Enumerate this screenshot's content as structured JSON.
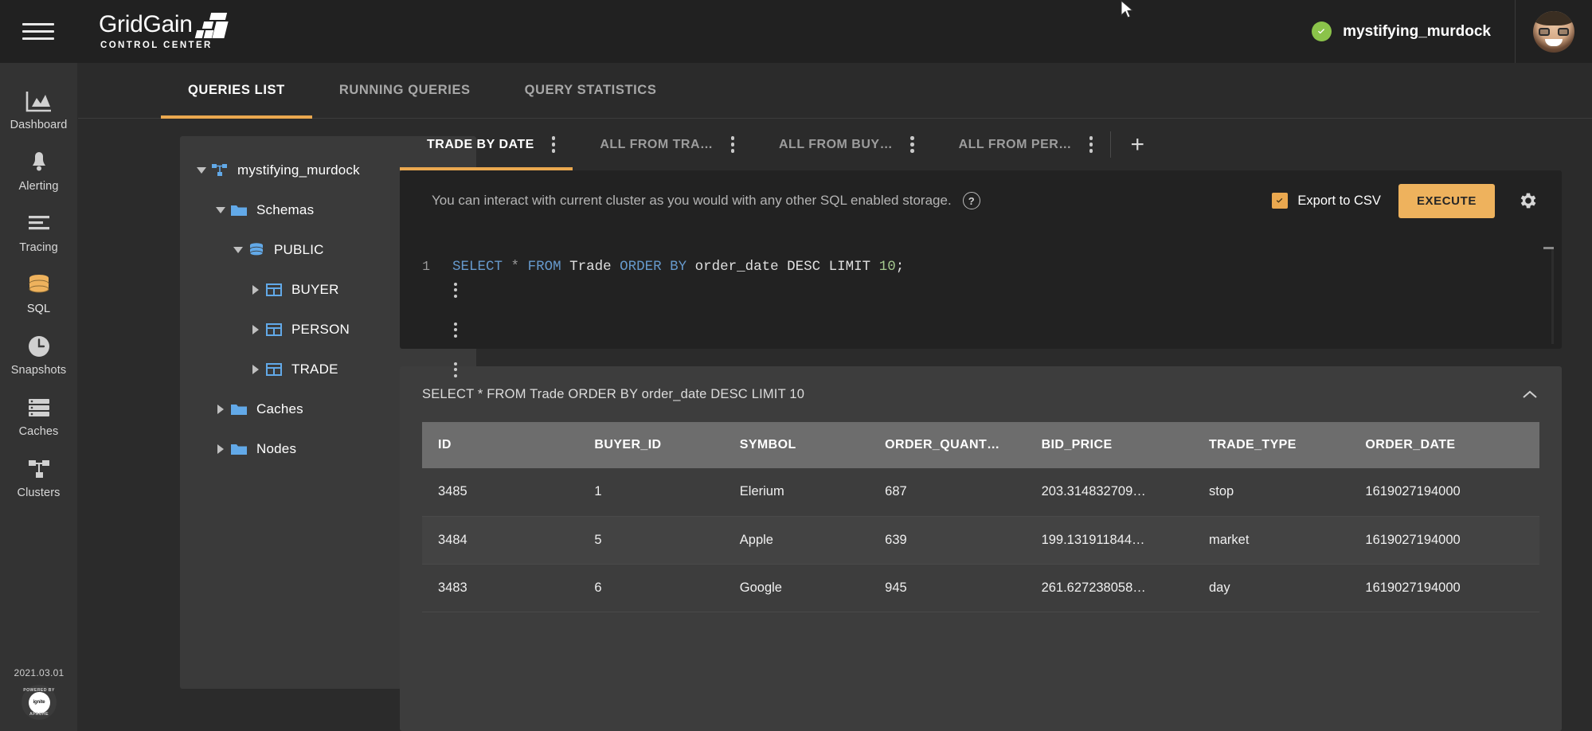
{
  "topbar": {
    "menu_icon": "hamburger-icon",
    "brand_name": "GridGain",
    "brand_sub": "CONTROL CENTER",
    "cluster_name": "mystifying_murdock",
    "status_icon": "check-circle-icon",
    "status_color": "#8bc34a",
    "avatar_alt": "user-avatar"
  },
  "rail": {
    "items": [
      {
        "label": "Dashboard",
        "icon": "chart-area-icon",
        "active": false
      },
      {
        "label": "Alerting",
        "icon": "bell-icon",
        "active": false
      },
      {
        "label": "Tracing",
        "icon": "lines-icon",
        "active": false
      },
      {
        "label": "SQL",
        "icon": "database-icon",
        "active": true
      },
      {
        "label": "Snapshots",
        "icon": "clock-icon",
        "active": false
      },
      {
        "label": "Caches",
        "icon": "server-icon",
        "active": false
      },
      {
        "label": "Clusters",
        "icon": "topology-icon",
        "active": false
      }
    ],
    "version": "2021.03.01",
    "badge_top": "POWERED BY",
    "badge_bottom": "APACHE",
    "badge_inner": "ignite"
  },
  "nav_tabs": [
    {
      "label": "QUERIES LIST",
      "active": true
    },
    {
      "label": "RUNNING QUERIES",
      "active": false
    },
    {
      "label": "QUERY STATISTICS",
      "active": false
    }
  ],
  "tree": {
    "nodes": [
      {
        "label": "mystifying_murdock",
        "icon": "cluster-topology-icon",
        "indent": 0,
        "caret": "down",
        "kebab": false
      },
      {
        "label": "Schemas",
        "icon": "folder-icon",
        "indent": 1,
        "caret": "down",
        "kebab": false
      },
      {
        "label": "PUBLIC",
        "icon": "schema-db-icon",
        "indent": 2,
        "caret": "down",
        "kebab": false
      },
      {
        "label": "BUYER",
        "icon": "table-icon",
        "indent": 3,
        "caret": "right",
        "kebab": true
      },
      {
        "label": "PERSON",
        "icon": "table-icon",
        "indent": 3,
        "caret": "right",
        "kebab": true
      },
      {
        "label": "TRADE",
        "icon": "table-icon",
        "indent": 3,
        "caret": "right",
        "kebab": true
      },
      {
        "label": "Caches",
        "icon": "folder-icon",
        "indent": 1,
        "caret": "right",
        "kebab": false
      },
      {
        "label": "Nodes",
        "icon": "folder-icon",
        "indent": 1,
        "caret": "right",
        "kebab": false
      }
    ]
  },
  "query_tabs": {
    "tabs": [
      {
        "label": "TRADE BY DATE",
        "active": true
      },
      {
        "label": "ALL FROM TRA…",
        "active": false
      },
      {
        "label": "ALL FROM BUY…",
        "active": false
      },
      {
        "label": "ALL FROM PER…",
        "active": false
      }
    ],
    "add_label": "+"
  },
  "editor": {
    "hint": "You can interact with current cluster as you would with any other SQL enabled storage.",
    "hint_icon": "?",
    "export_label": "Export to CSV",
    "export_checked": true,
    "execute_label": "EXECUTE",
    "settings_icon": "gear-icon",
    "line_number": "1",
    "sql_tokens": [
      {
        "t": "SELECT",
        "c": "kw"
      },
      {
        "t": " ",
        "c": "plain"
      },
      {
        "t": "*",
        "c": "op"
      },
      {
        "t": " ",
        "c": "plain"
      },
      {
        "t": "FROM",
        "c": "kw"
      },
      {
        "t": " Trade ",
        "c": "plain"
      },
      {
        "t": "ORDER",
        "c": "kw"
      },
      {
        "t": " ",
        "c": "plain"
      },
      {
        "t": "BY",
        "c": "kw"
      },
      {
        "t": " order_date DESC LIMIT ",
        "c": "plain"
      },
      {
        "t": "10",
        "c": "num"
      },
      {
        "t": ";",
        "c": "plain"
      }
    ]
  },
  "results": {
    "title": "SELECT * FROM Trade ORDER BY order_date DESC LIMIT 10",
    "collapse_icon": "chevron-up-icon",
    "columns": [
      "ID",
      "BUYER_ID",
      "SYMBOL",
      "ORDER_QUANT…",
      "BID_PRICE",
      "TRADE_TYPE",
      "ORDER_DATE"
    ],
    "rows": [
      [
        "3485",
        "1",
        "Elerium",
        "687",
        "203.314832709…",
        "stop",
        "1619027194000"
      ],
      [
        "3484",
        "5",
        "Apple",
        "639",
        "199.131911844…",
        "market",
        "1619027194000"
      ],
      [
        "3483",
        "6",
        "Google",
        "945",
        "261.627238058…",
        "day",
        "1619027194000"
      ]
    ]
  },
  "colors": {
    "accent": "#eaa84f",
    "topbar_bg": "#212121",
    "rail_bg": "#333333",
    "content_bg": "#2b2b2b",
    "panel_bg": "#3a3a3a",
    "editor_bg": "#222222",
    "table_header_bg": "#6d6d6d",
    "tree_blue": "#62a9e8",
    "status_green": "#8bc34a"
  }
}
